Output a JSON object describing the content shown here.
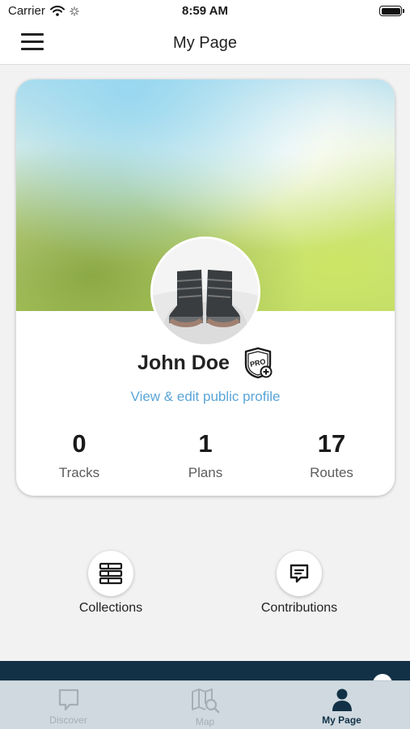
{
  "status_bar": {
    "carrier": "Carrier",
    "time": "8:59 AM"
  },
  "header": {
    "title": "My Page"
  },
  "profile": {
    "name": "John Doe",
    "badge": "PRO",
    "edit_link": "View & edit public profile",
    "stats": [
      {
        "value": "0",
        "label": "Tracks"
      },
      {
        "value": "1",
        "label": "Plans"
      },
      {
        "value": "17",
        "label": "Routes"
      }
    ]
  },
  "actions": [
    {
      "label": "Collections",
      "icon": "collections-icon"
    },
    {
      "label": "Contributions",
      "icon": "contributions-icon"
    }
  ],
  "tabs": [
    {
      "label": "Discover",
      "icon": "discover-icon",
      "active": false
    },
    {
      "label": "Map",
      "icon": "map-search-icon",
      "active": false
    },
    {
      "label": "My Page",
      "icon": "user-icon",
      "active": true
    }
  ],
  "colors": {
    "accent_link": "#5aa5d8",
    "brand_dark": "#123146",
    "tab_bar": "#cfd9df"
  }
}
